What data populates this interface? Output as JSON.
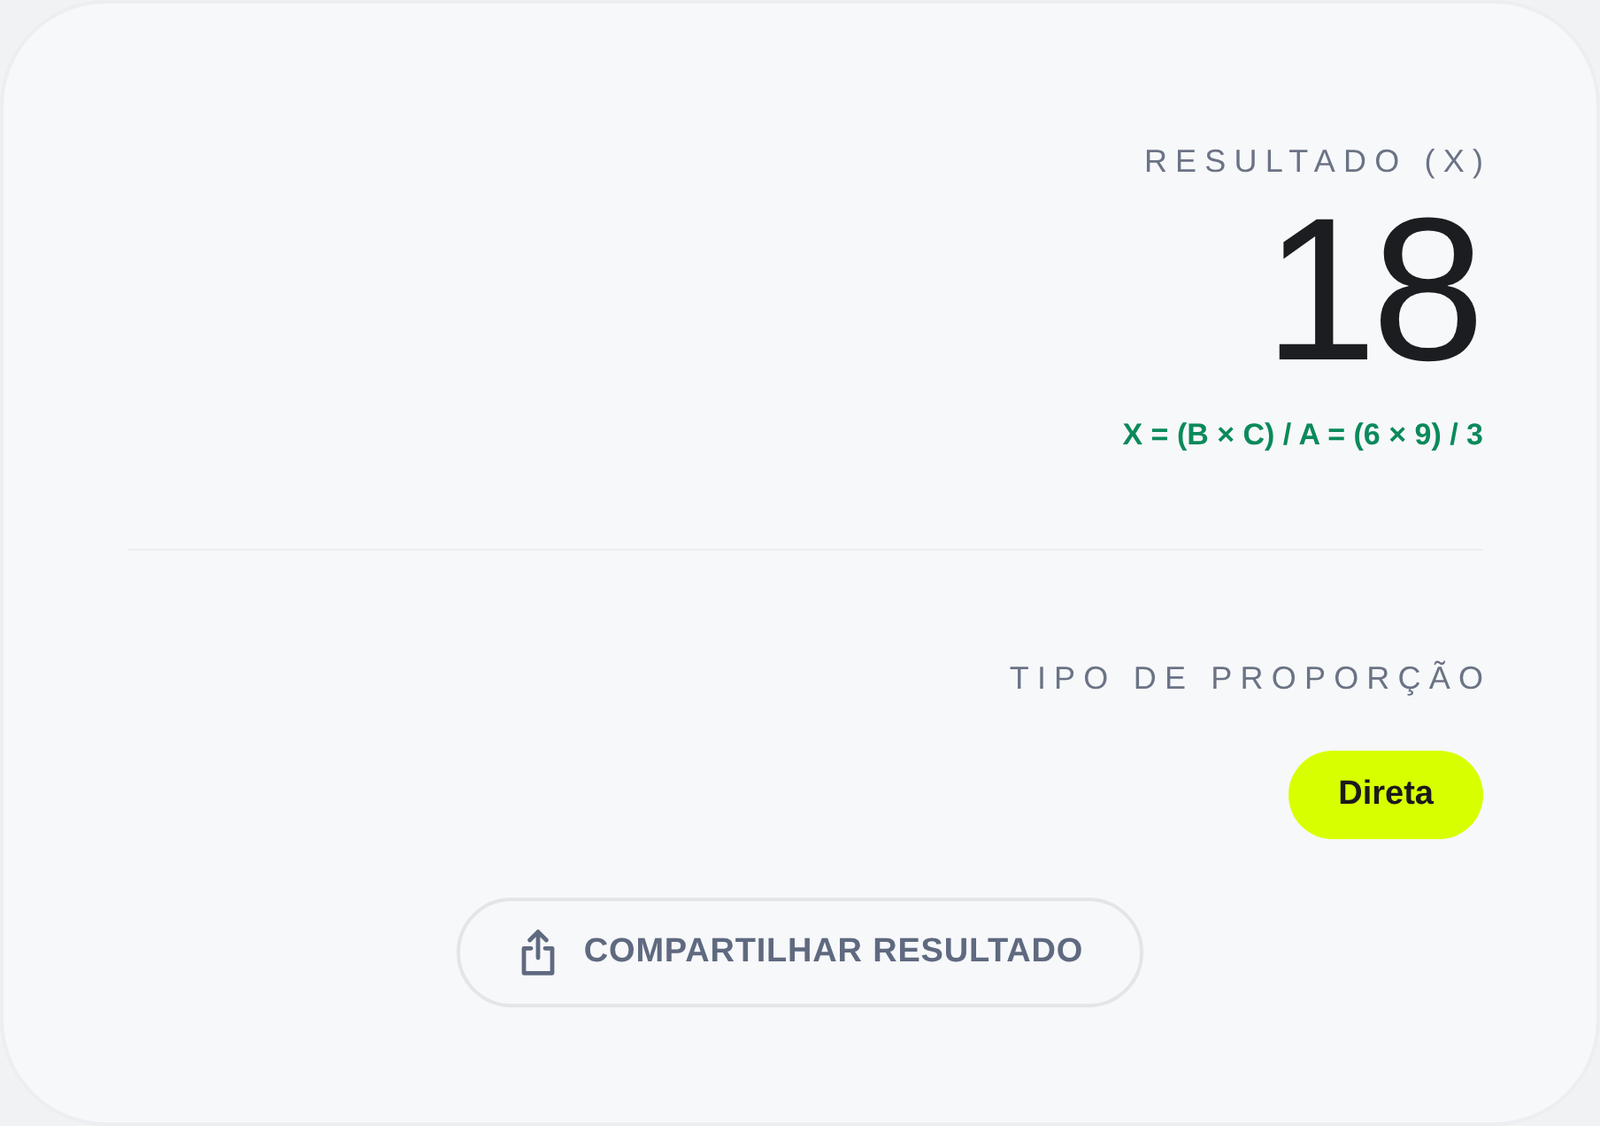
{
  "result": {
    "label": "RESULTADO (X)",
    "value": "18",
    "formula": "X = (B × C) / A = (6 × 9) / 3"
  },
  "proportion": {
    "label": "TIPO DE PROPORÇÃO",
    "type": "Direta"
  },
  "share_button": {
    "label": "COMPARTILHAR RESULTADO"
  }
}
